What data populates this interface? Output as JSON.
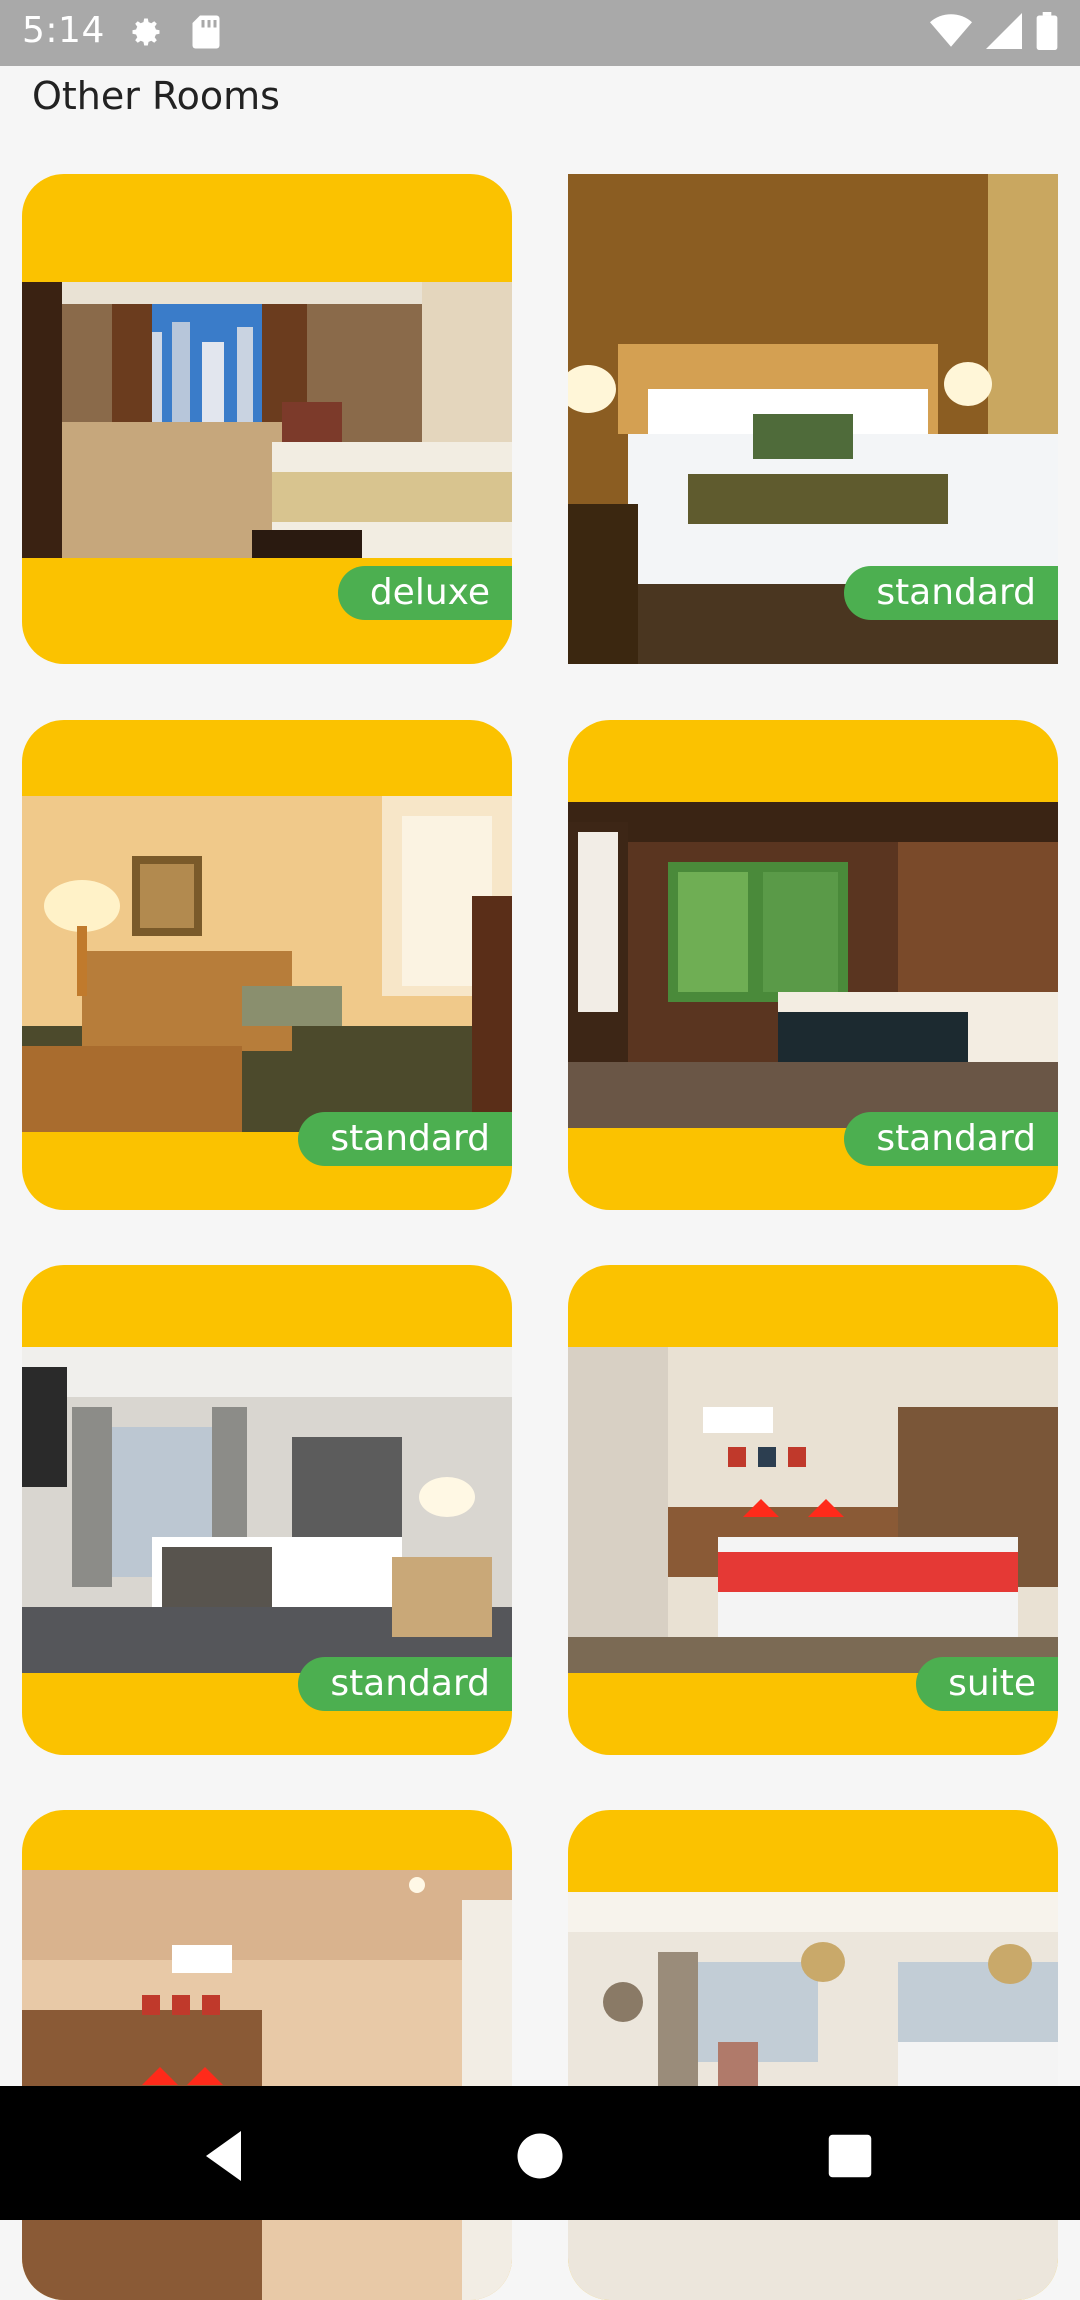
{
  "status": {
    "time": "5:14"
  },
  "header": {
    "title": "Other Rooms"
  },
  "rooms": [
    {
      "type": "deluxe"
    },
    {
      "type": "standard"
    },
    {
      "type": "standard"
    },
    {
      "type": "standard"
    },
    {
      "type": "standard"
    },
    {
      "type": "suite"
    }
  ],
  "colors": {
    "card": "#FBC200",
    "badge": "#4CAF50"
  },
  "nav": {
    "back": "back-icon",
    "home": "home-icon",
    "recents": "recents-icon"
  }
}
